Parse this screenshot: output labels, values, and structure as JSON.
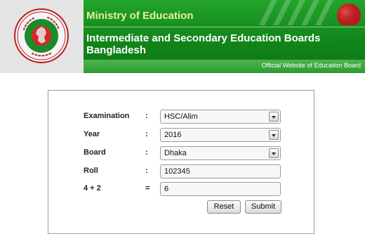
{
  "header": {
    "ministry": "Ministry of Education",
    "board_name_line1": "Intermediate and Secondary Education Boards",
    "board_name_line2": "Bangladesh",
    "official": "Official Website of Education Board",
    "logo_icon": "government-seal-icon",
    "colors": {
      "green": "#12851a",
      "ministry_text": "#e8f09a",
      "logo_background": "#e4e4e4"
    }
  },
  "form": {
    "fields": [
      {
        "label": "Examination",
        "colon": ":",
        "value": "HSC/Alim"
      },
      {
        "label": "Year",
        "colon": ":",
        "value": "2016"
      },
      {
        "label": "Board",
        "colon": ":",
        "value": "Dhaka"
      },
      {
        "label": "Roll",
        "colon": ":",
        "value": "102345"
      },
      {
        "label": "4 + 2",
        "colon": "=",
        "value": "6"
      }
    ],
    "reset_label": "Reset",
    "submit_label": "Submit"
  }
}
